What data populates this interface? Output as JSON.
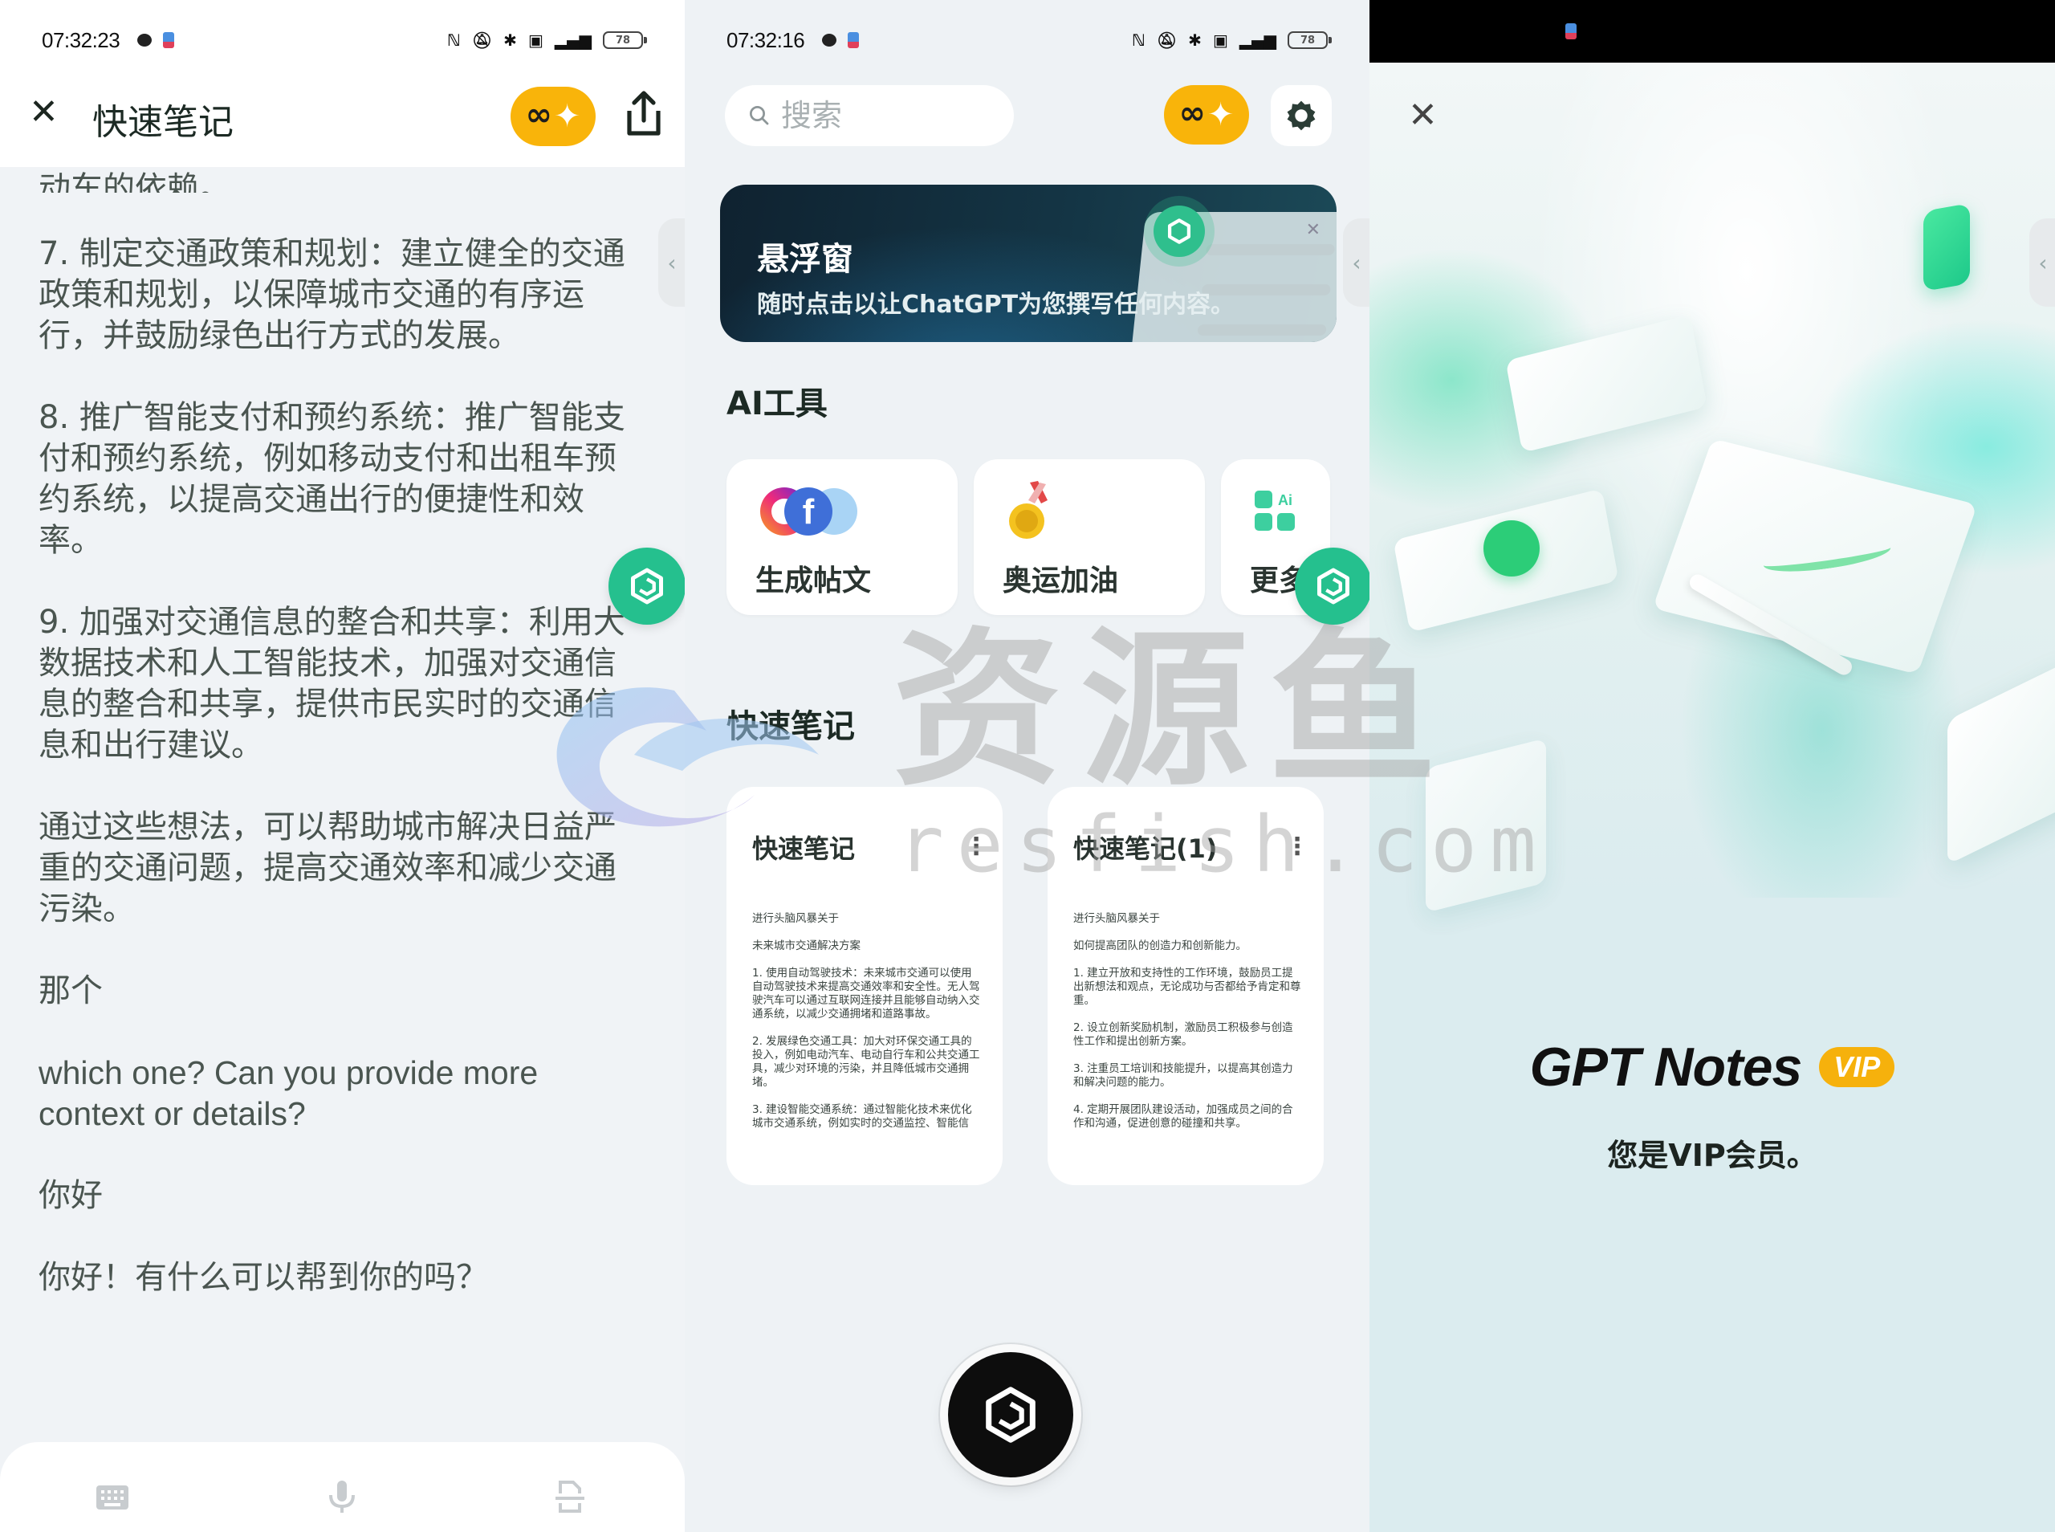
{
  "panels": {
    "note_editor": {
      "status_bar": {
        "time": "07:32:23",
        "battery": "78"
      },
      "header": {
        "close_icon": "close-icon",
        "title": "快速笔记",
        "pro_badge_icon": "infinity-sparkle-icon",
        "share_icon": "share-icon"
      },
      "content": {
        "paragraphs": [
          "动车的依赖。",
          "7. 制定交通政策和规划：建立健全的交通政策和规划，以保障城市交通的有序运行，并鼓励绿色出行方式的发展。",
          "8. 推广智能支付和预约系统：推广智能支付和预约系统，例如移动支付和出租车预约系统，以提高交通出行的便捷性和效率。",
          "9. 加强对交通信息的整合和共享：利用大数据技术和人工智能技术，加强对交通信息的整合和共享，提供市民实时的交通信息和出行建议。",
          "通过这些想法，可以帮助城市解决日益严重的交通问题，提高交通效率和减少交通污染。",
          "那个",
          " which one? Can you provide more context or details?",
          "你好",
          "你好！有什么可以帮到你的吗？"
        ]
      },
      "bottom_bar": {
        "buttons": [
          "keyboard-icon",
          "microphone-icon",
          "scan-document-icon"
        ]
      },
      "edge_tab_icon": "chevron-left-icon",
      "float_button_icon": "app-logo-icon"
    },
    "home": {
      "status_bar": {
        "time": "07:32:16",
        "battery": "78"
      },
      "search": {
        "placeholder": "搜索",
        "value": ""
      },
      "banner": {
        "title": "悬浮窗",
        "subtitle": "随时点击以让ChatGPT为您撰写任何内容。"
      },
      "ai_tools": {
        "title": "AI工具",
        "items": [
          {
            "label": "生成帖文",
            "icon": "social-media-icon"
          },
          {
            "label": "奥运加油",
            "icon": "medal-icon"
          },
          {
            "label": "更多",
            "icon": "ai-grid-icon"
          }
        ]
      },
      "quick_notes": {
        "title": "快速笔记",
        "items": [
          {
            "title": "快速笔记",
            "preview": [
              "进行头脑风暴关于",
              "未来城市交通解决方案",
              "1. 使用自动驾驶技术：未来城市交通可以使用自动驾驶技术来提高交通效率和安全性。无人驾驶汽车可以通过互联网连接并且能够自动纳入交通系统，以减少交通拥堵和道路事故。",
              "2. 发展绿色交通工具：加大对环保交通工具的投入，例如电动汽车、电动自行车和公共交通工具，减少对环境的污染，并且降低城市交通拥堵。",
              "3. 建设智能交通系统：通过智能化技术来优化城市交通系统，例如实时的交通监控、智能信"
            ]
          },
          {
            "title": "快速笔记(1)",
            "preview": [
              "进行头脑风暴关于",
              "如何提高团队的创造力和创新能力。",
              "1. 建立开放和支持性的工作环境，鼓励员工提出新想法和观点，无论成功与否都给予肯定和尊重。",
              "2. 设立创新奖励机制，激励员工积极参与创造性工作和提出创新方案。",
              "3. 注重员工培训和技能提升，以提高其创造力和解决问题的能力。",
              "4. 定期开展团队建设活动，加强成员之间的合作和沟通，促进创意的碰撞和共享。"
            ]
          }
        ]
      },
      "fab_icon": "app-logo-icon"
    },
    "vip": {
      "close_icon": "close-icon",
      "app_name": "GPT Notes",
      "badge": "VIP",
      "message": "您是VIP会员。"
    }
  },
  "watermark": {
    "cn": "资源鱼",
    "en": "resfish.com"
  },
  "colors": {
    "accent_green": "#25c08e",
    "pro_yellow": "#f9b40a",
    "text_dark": "#1c2a24"
  }
}
